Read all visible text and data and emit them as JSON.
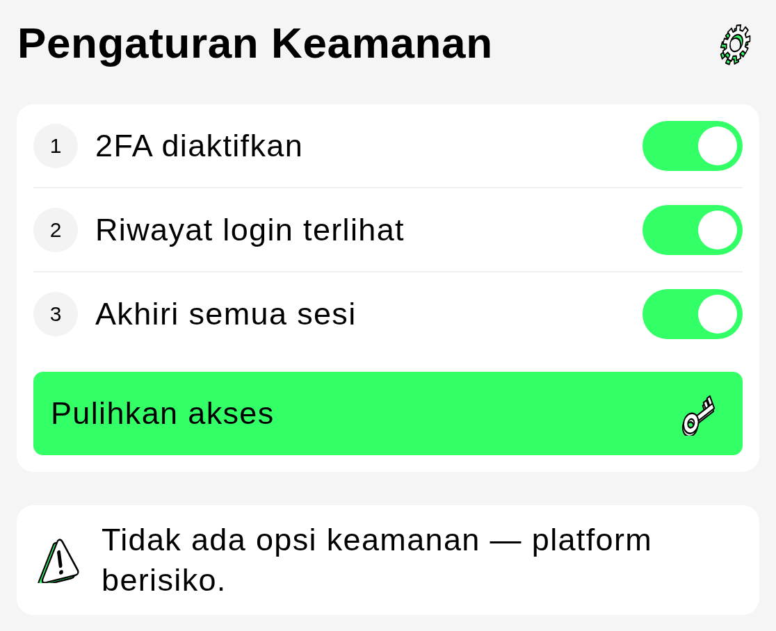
{
  "header": {
    "title": "Pengaturan Keamanan"
  },
  "settings": [
    {
      "number": "1",
      "label": "2FA diaktifkan",
      "on": true
    },
    {
      "number": "2",
      "label": "Riwayat login terlihat",
      "on": true
    },
    {
      "number": "3",
      "label": "Akhiri semua sesi",
      "on": true
    }
  ],
  "action_button": {
    "label": "Pulihkan akses"
  },
  "notice": {
    "text": "Tidak ada opsi keamanan — platform berisiko."
  }
}
